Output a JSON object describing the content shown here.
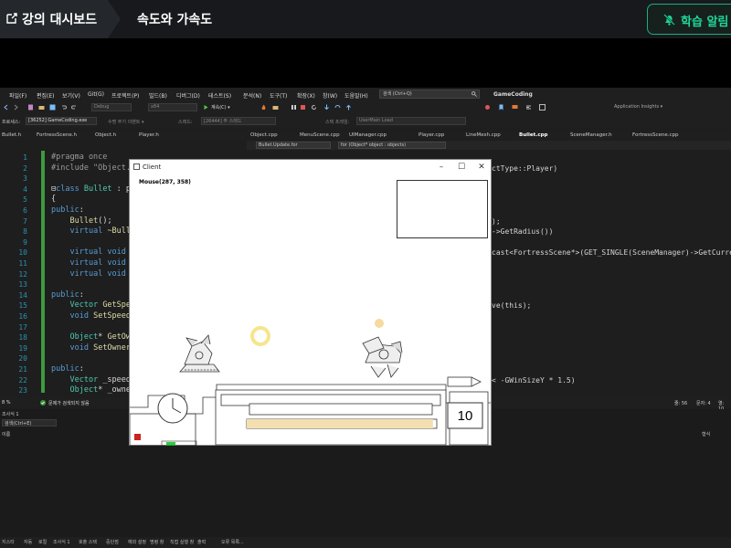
{
  "header": {
    "dashboard_label": "강의 대시보드",
    "lesson_title": "속도와 가속도",
    "alarm_label": "학습 알림"
  },
  "vs": {
    "menu": [
      "파일(F)",
      "편집(E)",
      "보기(V)",
      "Git(G)",
      "프로젝트(P)",
      "빌드(B)",
      "디버그(D)",
      "테스트(S)",
      "분석(N)",
      "도구(T)",
      "확장(X)",
      "창(W)",
      "도움말(H)"
    ],
    "search_placeholder": "검색 (Ctrl+Q)",
    "solution_name": "GameCoding",
    "toolbar": {
      "config": "Debug",
      "platform": "x64",
      "run_label": "계속(C) ▾",
      "insights": "Application Insights ▾"
    },
    "toolbar2": {
      "process_label": "프로세스:",
      "process_value": "[36252] GameCoding.exe",
      "lifecycle_label": "수명 주기 이벤트 ▾",
      "thread_label": "스레드:",
      "thread_value": "[26444] 주 스레드",
      "stackframe_label": "스택 프레임:",
      "stackframe_value": "UserMain Load"
    },
    "left_tabs": [
      "Bullet.h",
      "FortressScene.h",
      "Object.h",
      "Player.h"
    ],
    "right_tabs": [
      "Object.cpp",
      "MenuScene.cpp",
      "UIManager.cpp",
      "Player.cpp",
      "LineMesh.cpp",
      "Bullet.cpp",
      "SceneManager.h",
      "FortressScene.cpp"
    ],
    "active_right_tab": "Bullet.cpp",
    "nav_left": "Bullet.Update.for",
    "nav_right": "for (Object* object : objects)",
    "line_numbers": [
      "1",
      "2",
      "3",
      "4",
      "5",
      "6",
      "7",
      "8",
      "9",
      "10",
      "11",
      "12",
      "13",
      "14",
      "15",
      "16",
      "17",
      "18",
      "19",
      "20",
      "21",
      "22",
      "23"
    ],
    "code_lines": [
      [
        {
          "c": "pp",
          "t": "#pragma once"
        }
      ],
      [
        {
          "c": "pp",
          "t": "#include \"Object.h"
        }
      ],
      [],
      [
        {
          "c": "pu",
          "t": "⊟"
        },
        {
          "c": "kw",
          "t": "class "
        },
        {
          "c": "ty",
          "t": "Bullet"
        },
        {
          "c": "tx",
          "t": " : pub"
        }
      ],
      [
        {
          "c": "tx",
          "t": "{"
        }
      ],
      [
        {
          "c": "kw",
          "t": "public"
        },
        {
          "c": "tx",
          "t": ":"
        }
      ],
      [
        {
          "c": "tx",
          "t": "    "
        },
        {
          "c": "fn",
          "t": "Bullet"
        },
        {
          "c": "tx",
          "t": "();"
        }
      ],
      [
        {
          "c": "tx",
          "t": "    "
        },
        {
          "c": "kw",
          "t": "virtual "
        },
        {
          "c": "fn",
          "t": "~Bulle"
        }
      ],
      [],
      [
        {
          "c": "tx",
          "t": "    "
        },
        {
          "c": "kw",
          "t": "virtual void "
        }
      ],
      [
        {
          "c": "tx",
          "t": "    "
        },
        {
          "c": "kw",
          "t": "virtual void "
        }
      ],
      [
        {
          "c": "tx",
          "t": "    "
        },
        {
          "c": "kw",
          "t": "virtual void "
        }
      ],
      [],
      [
        {
          "c": "kw",
          "t": "public"
        },
        {
          "c": "tx",
          "t": ":"
        }
      ],
      [
        {
          "c": "tx",
          "t": "    "
        },
        {
          "c": "ty",
          "t": "Vector "
        },
        {
          "c": "fn",
          "t": "GetSpee"
        }
      ],
      [
        {
          "c": "tx",
          "t": "    "
        },
        {
          "c": "kw",
          "t": "void "
        },
        {
          "c": "fn",
          "t": "SetSpeed"
        }
      ],
      [],
      [
        {
          "c": "tx",
          "t": "    "
        },
        {
          "c": "ty",
          "t": "Object"
        },
        {
          "c": "tx",
          "t": "* "
        },
        {
          "c": "fn",
          "t": "GetOwn"
        }
      ],
      [
        {
          "c": "tx",
          "t": "    "
        },
        {
          "c": "kw",
          "t": "void "
        },
        {
          "c": "fn",
          "t": "SetOwner"
        }
      ],
      [],
      [
        {
          "c": "kw",
          "t": "public"
        },
        {
          "c": "tx",
          "t": ":"
        }
      ],
      [
        {
          "c": "tx",
          "t": "    "
        },
        {
          "c": "ty",
          "t": "Vector "
        },
        {
          "c": "tx",
          "t": "_speed"
        }
      ],
      [
        {
          "c": "tx",
          "t": "    "
        },
        {
          "c": "ty",
          "t": "Object"
        },
        {
          "c": "tx",
          "t": "* _owner"
        }
      ]
    ],
    "right_code_lines": [
      {
        "line": 1,
        "text": "ctType::Player)"
      },
      {
        "line": 6,
        "text": ");"
      },
      {
        "line": 7,
        "text": "->GetRadius())"
      },
      {
        "line": 9,
        "text": "cast<FortressScene*>(GET_SINGLE(SceneManager)->GetCurren"
      },
      {
        "line": 14,
        "text": "ve(this);"
      },
      {
        "line": 21,
        "text": "< -GWinSizeY * 1.5)"
      },
      {
        "line": 23,
        "text": "<FortressScene*>(GET_SINGLE(SceneManager)->GetCurrentSc"
      }
    ],
    "status_left": "문제가 검색되지 않음",
    "status_left_zoom": "8 %",
    "status_right": {
      "line": "줄: 56",
      "char": "문자: 4",
      "col": "열: 10"
    },
    "lower_panel": {
      "title": "조사식 1",
      "search": "검색(Ctrl+E)",
      "col_name": "이름",
      "col_type": "형식"
    },
    "bottom_tabs": [
      "지스타",
      "자동",
      "로컬",
      "조사식 1",
      "호출 스택",
      "중단점",
      "예외 설정",
      "명령 창",
      "직접 실행 창",
      "출력",
      "오류 목록..."
    ]
  },
  "client": {
    "title": "Client",
    "mouse_text": "Mouse(287, 358)",
    "wind_value": "10",
    "gauge_fill_fraction": 0.35,
    "colors": {
      "accent": "#1fd79a",
      "sun": "#f6e58d",
      "health": "#2ecc40",
      "marker": "#cc2222",
      "power_bar": "#f3dfb0"
    }
  }
}
